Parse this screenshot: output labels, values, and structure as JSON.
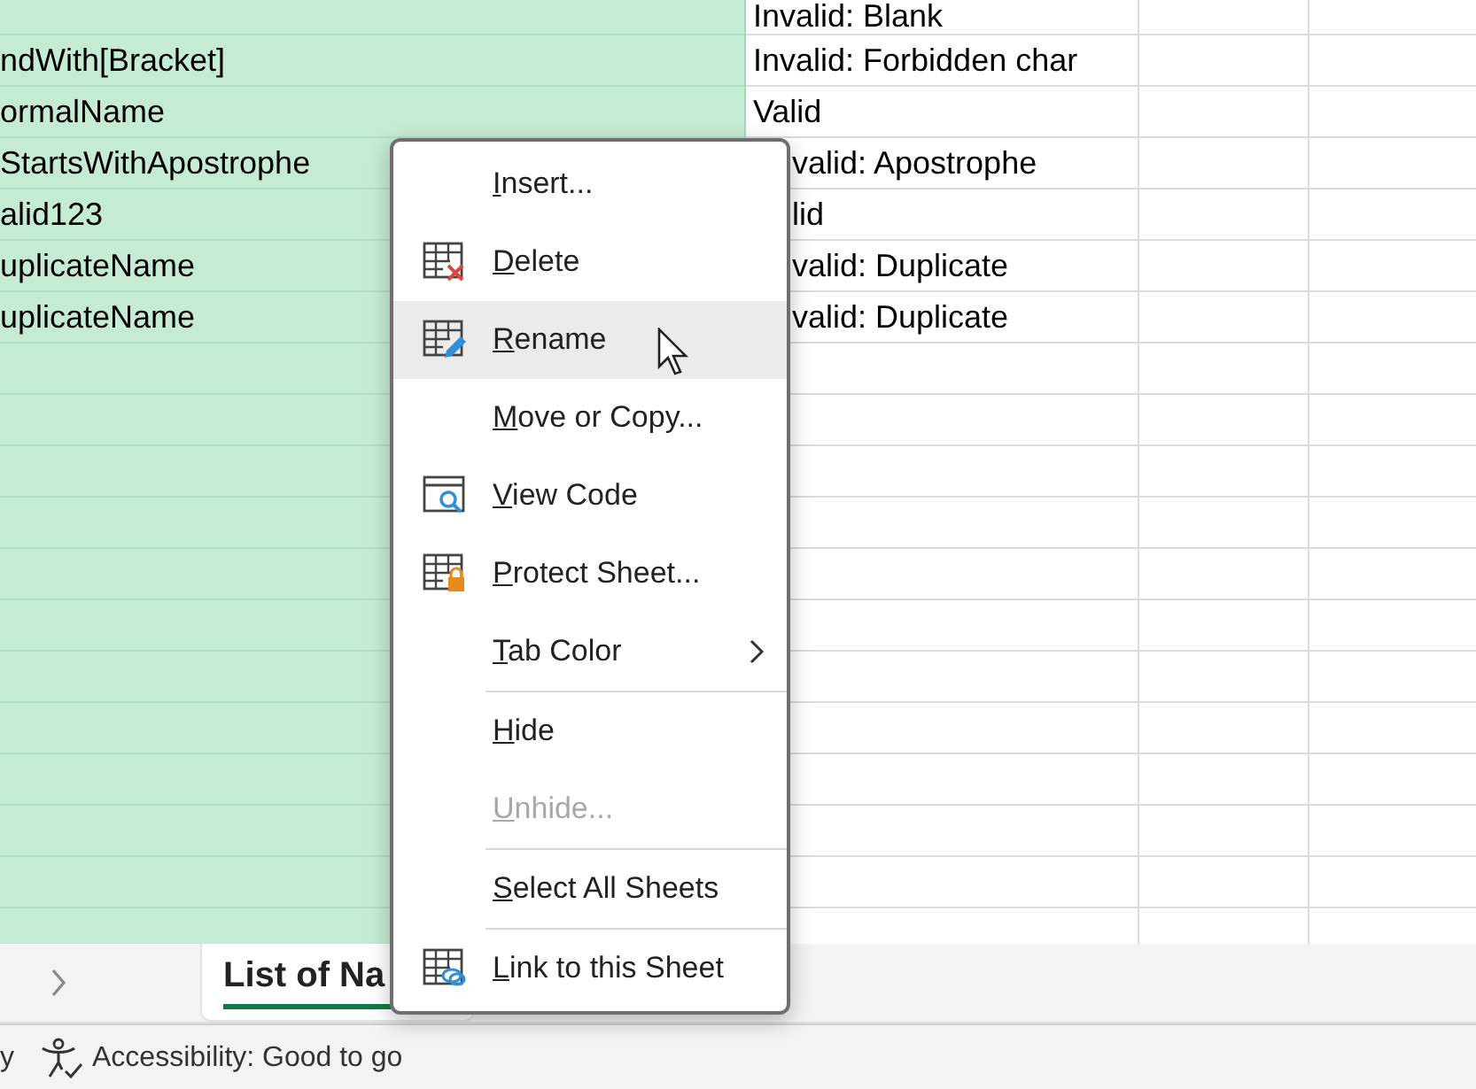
{
  "sheet": {
    "name_column_selected": true,
    "rows": [
      {
        "status": "Invalid: Blank"
      },
      {
        "name": "ndWith[Bracket]",
        "status": "Invalid: Forbidden char"
      },
      {
        "name": "ormalName",
        "status": "Valid"
      },
      {
        "name": "StartsWithApostrophe",
        "status": "valid: Apostrophe"
      },
      {
        "name": "alid123",
        "status": "lid"
      },
      {
        "name": "uplicateName",
        "status": "valid: Duplicate"
      },
      {
        "name": "uplicateName",
        "status": "valid: Duplicate"
      }
    ]
  },
  "sheet_tabs": [
    {
      "label": "List of Na",
      "selected": true
    }
  ],
  "context_menu": {
    "items": [
      {
        "kind": "plain",
        "label": "Insert...",
        "selected": false,
        "disabled": false,
        "submenu": false
      },
      {
        "kind": "delete",
        "label": "Delete",
        "selected": false,
        "disabled": false,
        "submenu": false
      },
      {
        "kind": "rename",
        "label": "Rename",
        "selected": true,
        "disabled": false,
        "submenu": false
      },
      {
        "kind": "plain",
        "label": "Move or Copy...",
        "selected": false,
        "disabled": false,
        "submenu": false
      },
      {
        "kind": "code",
        "label": "View Code",
        "selected": false,
        "disabled": false,
        "submenu": false
      },
      {
        "kind": "protect",
        "label": "Protect Sheet...",
        "selected": false,
        "disabled": false,
        "submenu": false
      },
      {
        "kind": "plain",
        "label": "Tab Color",
        "selected": false,
        "disabled": false,
        "submenu": true
      },
      {
        "kind": "separator"
      },
      {
        "kind": "plain",
        "label": "Hide",
        "selected": false,
        "disabled": false,
        "submenu": false
      },
      {
        "kind": "plain",
        "label": "Unhide...",
        "selected": false,
        "disabled": true,
        "submenu": false
      },
      {
        "kind": "separator"
      },
      {
        "kind": "plain",
        "label": "Select All Sheets",
        "selected": false,
        "disabled": false,
        "submenu": false
      },
      {
        "kind": "separator"
      },
      {
        "kind": "link",
        "label": "Link to this Sheet",
        "selected": false,
        "disabled": false,
        "submenu": false
      }
    ]
  },
  "status_bar": {
    "left_text": "y",
    "accessibility": "Accessibility: Good to go"
  }
}
